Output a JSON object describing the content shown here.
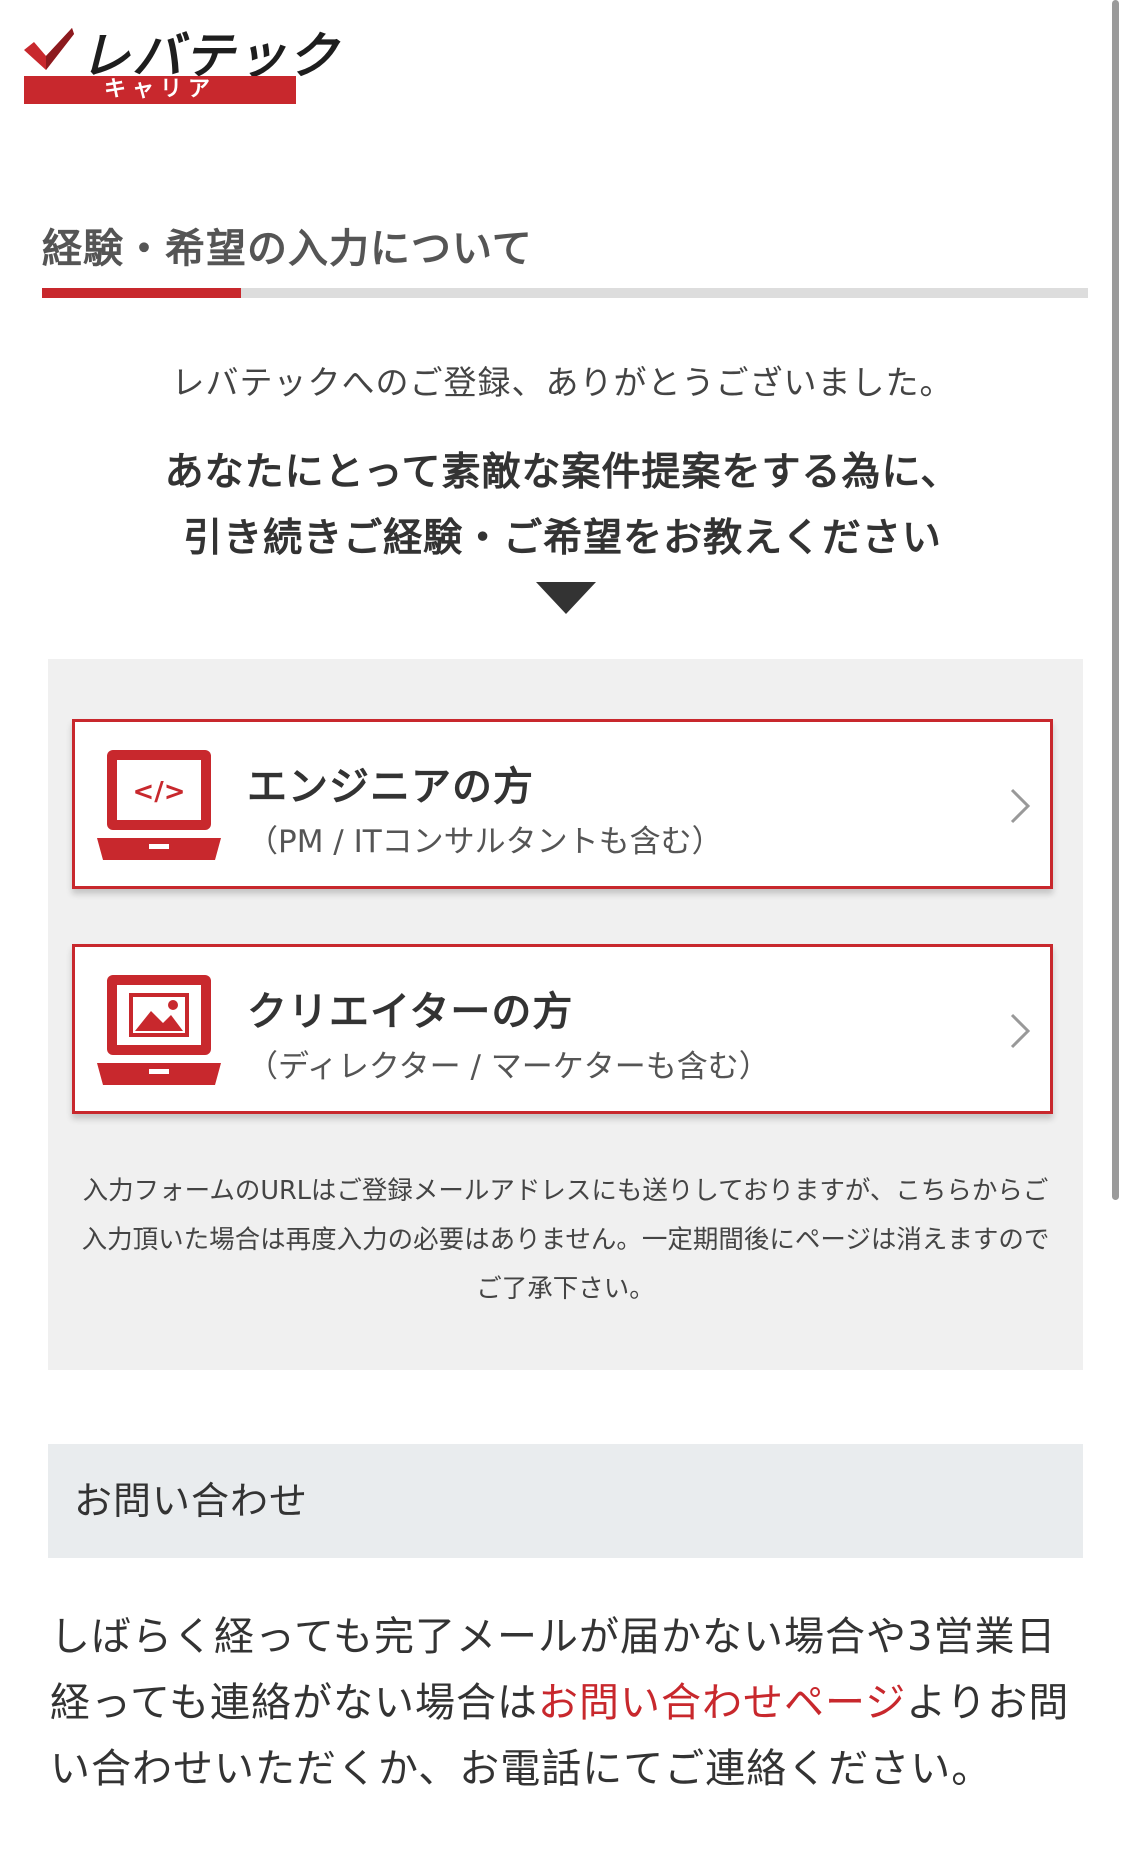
{
  "header": {
    "logo_text": "レバテック",
    "logo_subtext": "キャリア"
  },
  "page": {
    "title": "経験・希望の入力について",
    "progress_fraction": 0.19,
    "thanks": "レバテックへのご登録、ありがとうございました。",
    "lead_line1": "あなたにとって素敵な案件提案をする為に、",
    "lead_line2": "引き続きご経験・ご希望をお教えください"
  },
  "options": [
    {
      "icon": "laptop-code-icon",
      "title": "エンジニアの方",
      "subtitle": "（PM / ITコンサルタントも含む）"
    },
    {
      "icon": "laptop-image-icon",
      "title": "クリエイターの方",
      "subtitle": "（ディレクター / マーケターも含む）"
    }
  ],
  "notice": "入力フォームのURLはご登録メールアドレスにも送りしておりますが、こちらからご入力頂いた場合は再度入力の必要はありません。一定期間後にページは消えますのでご了承下さい。",
  "contact": {
    "heading": "お問い合わせ",
    "text_before": "しばらく経っても完了メールが届かない場合や3営業日経っても連絡がない場合は",
    "link_text": "お問い合わせページ",
    "text_after": "よりお問い合わせいただくか、お電話にてご連絡ください。"
  },
  "colors": {
    "brand_red": "#c8282d",
    "panel_gray": "#f0f0f0",
    "contact_header_gray": "#e9ecee"
  }
}
